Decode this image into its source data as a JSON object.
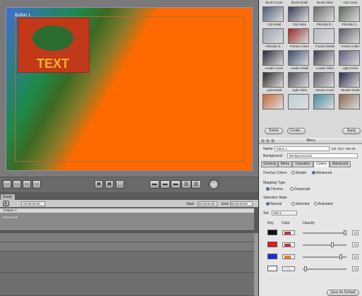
{
  "viewer": {
    "button_label": "Button 1",
    "button_text": "TEXT"
  },
  "timeline": {
    "tab": "Script",
    "current_time": "00:00:00:00",
    "start_label": "Start:",
    "start_value": "00:00:00:00",
    "end_label": "End:",
    "end_value": "00:00:00:00",
    "ruler": "00:00:00:00",
    "track_name": "Chapter 1"
  },
  "palette": {
    "rows": [
      [
        "Brush Cover",
        "Brush Detail",
        "Brush Index",
        "City Cover"
      ],
      [
        "City Detail",
        "City Index",
        "Filmstrip D...",
        "Filmstrip C..."
      ],
      [
        "Filmstrip In...",
        "Frames Cover",
        "Frames Detail",
        "Frames Index"
      ],
      [
        "Leader Cover",
        "Leader Detail",
        "Leader Index",
        "Light Cover"
      ],
      [
        "Light Detail",
        "Light Index",
        "Mosaic Cover",
        "Mosaic Detail"
      ],
      [
        "",
        "",
        "",
        ""
      ]
    ],
    "delete_label": "Delete",
    "create_label": "Create...",
    "apply_label": "Apply"
  },
  "inspector": {
    "title": "Menu",
    "name_label": "Name:",
    "name_value": "Menu 1",
    "est_size": "Est. Size: 168 KB",
    "background_label": "Background:",
    "background_value": "Background.pict",
    "tabs": [
      "General",
      "Menu",
      "Transition",
      "Colors",
      "Advanced"
    ],
    "overlay_colors_label": "Overlay Colors:",
    "overlay_simple": "Simple",
    "overlay_advanced": "Advanced",
    "mapping_type_label": "Mapping Type",
    "mapping_chroma": "Chroma",
    "mapping_grayscale": "Grayscale",
    "selection_state_label": "Selection State",
    "state_normal": "Normal",
    "state_selected": "Selected",
    "state_activated": "Activated",
    "set_label": "Set:",
    "set_value": "Set 1",
    "col_key": "Key",
    "col_color": "Color",
    "col_opacity": "Opacity",
    "opacity_values": [
      "15",
      "15",
      "15",
      "15"
    ],
    "save_button": "Save As Default"
  },
  "colors": {
    "keys": [
      "#111111",
      "#e41b17",
      "#1d2cd8",
      "#ffffff"
    ],
    "wells": [
      "#c0392b",
      "#c0392b",
      "#e67e22",
      "#e0e0e0"
    ],
    "accent": "#ff6a00"
  }
}
